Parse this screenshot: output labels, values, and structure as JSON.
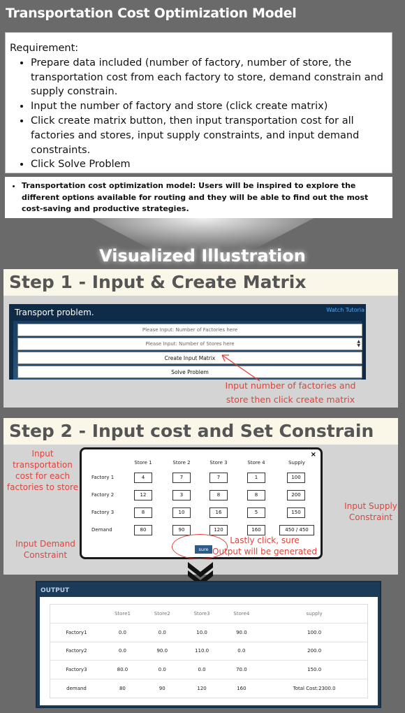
{
  "title": "Transportation Cost Optimization Model",
  "requirement": {
    "heading": "Requirement:",
    "items": [
      "Prepare data included (number of factory, number of store, the transportation cost from each factory to store, demand constrain and supply constrain.",
      "Input the number of factory and store (click create matrix)",
      "Click create matrix button, then input transportation cost for all factories and stores, input supply constraints, and input demand constraints.",
      "Click Solve Problem"
    ]
  },
  "model_note": "Transportation cost optimization model: Users will be inspired to explore the different options available for routing and they will be able to find out the most cost-saving and productive strategies.",
  "visual_title": "Visualized Illustration",
  "step1": {
    "heading": "Step 1 - Input & Create Matrix",
    "app_title": "Transport problem.",
    "tutorial_link": "Watch Tutoria",
    "factories_placeholder": "Please Input: Number of Factories here",
    "stores_placeholder": "Please Input: Number of Stores here",
    "create_button": "Create Input Matrix",
    "solve_button": "Solve Problem",
    "note_line1": "Input  number of factories and",
    "note_line2": "store then click create matrix"
  },
  "step2": {
    "heading": "Step 2 - Input cost and Set Constrain",
    "close": "×",
    "headers": [
      "Store 1",
      "Store 2",
      "Store 3",
      "Store 4",
      "Supply"
    ],
    "rows": [
      {
        "label": "Factory 1",
        "values": [
          "4",
          "7",
          "7",
          "1",
          "100"
        ]
      },
      {
        "label": "Factory 2",
        "values": [
          "12",
          "3",
          "8",
          "8",
          "200"
        ]
      },
      {
        "label": "Factory 3",
        "values": [
          "8",
          "10",
          "16",
          "5",
          "150"
        ]
      },
      {
        "label": "Demand",
        "values": [
          "80",
          "90",
          "120",
          "160",
          "450 / 450"
        ]
      }
    ],
    "sure_button": "sure",
    "note_cost": [
      "Input",
      "transportation",
      "cost for each",
      "factories to store"
    ],
    "note_supply": [
      "Input Supply",
      "Constraint"
    ],
    "note_demand": [
      "Input Demand",
      "Constraint"
    ],
    "note_sure": [
      "Lastly click, sure",
      "Output will be generated"
    ]
  },
  "output": {
    "title": "OUTPUT",
    "headers": [
      "",
      "Store1",
      "Store2",
      "Store3",
      "Store4",
      "supply"
    ],
    "rows": [
      [
        "Factory1",
        "0.0",
        "0.0",
        "10.0",
        "90.0",
        "100.0"
      ],
      [
        "Factory2",
        "0.0",
        "90.0",
        "110.0",
        "0.0",
        "200.0"
      ],
      [
        "Factory3",
        "80.0",
        "0.0",
        "0.0",
        "70.0",
        "150.0"
      ],
      [
        "demand",
        "80",
        "90",
        "120",
        "160",
        "Total Cost:2300.0"
      ]
    ]
  },
  "colors": {
    "background": "#6a6a6a",
    "step_header": "#fbf7e8",
    "app_navy": "#0f2b4a",
    "annotation_red": "#e0433a",
    "link_blue": "#4ea9ff"
  }
}
